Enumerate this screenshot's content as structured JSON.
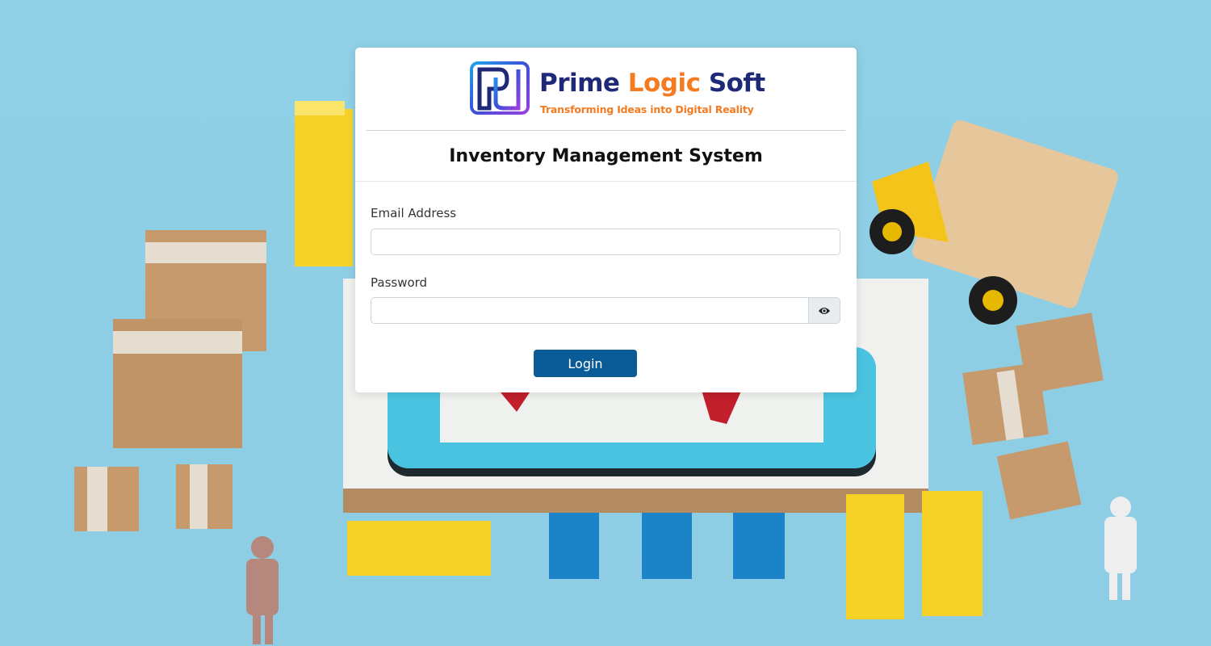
{
  "brand": {
    "name_part1": "Prime",
    "name_part2": "Logic",
    "name_part3": "Soft",
    "tagline": "Transforming Ideas into Digital Reality",
    "primary_color": "#1e2a78",
    "accent_color": "#f47b20"
  },
  "app_title": "Inventory Management System",
  "form": {
    "email_label": "Email Address",
    "email_value": "",
    "password_label": "Password",
    "password_value": "",
    "toggle_icon": "eye-icon",
    "login_label": "Login",
    "button_color": "#0b5c96"
  }
}
